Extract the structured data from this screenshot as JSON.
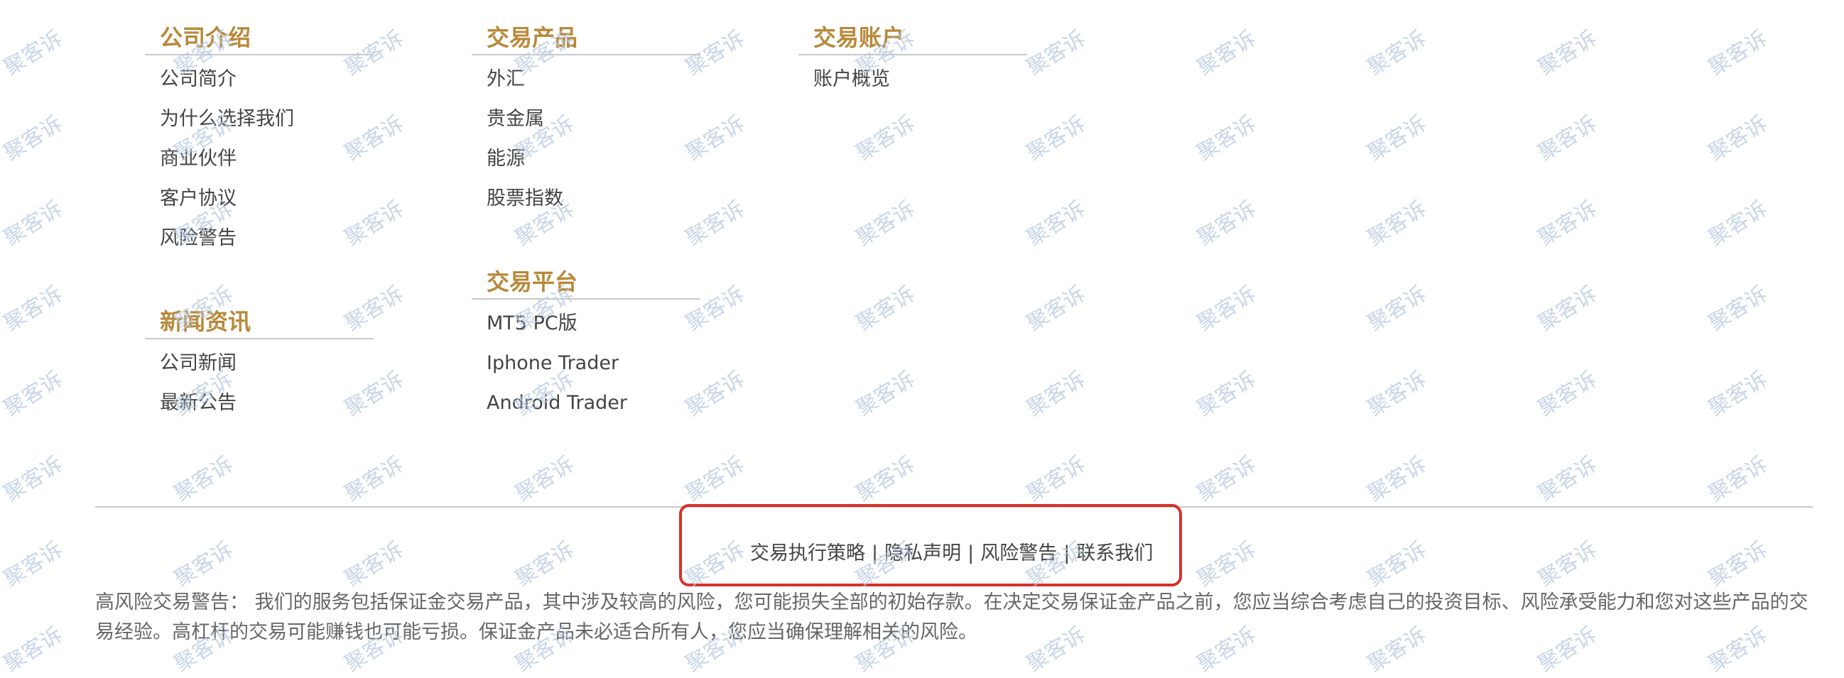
{
  "columns": [
    {
      "sections": [
        {
          "title": "公司介绍",
          "items": [
            "公司简介",
            "为什么选择我们",
            "商业伙伴",
            "客户协议",
            "风险警告"
          ]
        },
        {
          "title": "新闻资讯",
          "items": [
            "公司新闻",
            "最新公告"
          ]
        }
      ]
    },
    {
      "sections": [
        {
          "title": "交易产品",
          "items": [
            "外汇",
            "贵金属",
            "能源",
            "股票指数"
          ]
        },
        {
          "title": "交易平台",
          "items": [
            "MT5 PC版",
            "Iphone Trader",
            "Android Trader"
          ]
        }
      ]
    },
    {
      "sections": [
        {
          "title": "交易账户",
          "items": [
            "账户概览"
          ]
        }
      ]
    }
  ],
  "footer": {
    "links": [
      "交易执行策略",
      "隐私声明",
      "风险警告",
      "联系我们"
    ],
    "separator": "|",
    "risk_warning": "高风险交易警告： 我们的服务包括保证金交易产品，其中涉及较高的风险，您可能损失全部的初始存款。在决定交易保证金产品之前，您应当综合考虑自己的投资目标、风险承受能力和您对这些产品的交易经验。高杠杆的交易可能赚钱也可能亏损。保证金产品未必适合所有人，您应当确保理解相关的风险。"
  },
  "watermark": {
    "text": "聚客诉"
  },
  "colors": {
    "accent": "#b8893a",
    "highlight": "#d9302a",
    "text": "#444444"
  }
}
